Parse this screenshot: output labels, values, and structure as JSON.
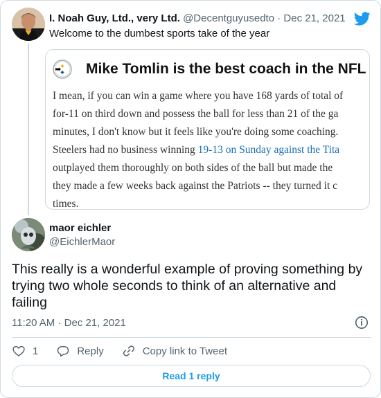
{
  "parent_tweet": {
    "author_name": "I. Noah Guy, Ltd., very Ltd.",
    "author_handle": "@Decentguyusedto",
    "separator": "·",
    "date": "Dec 21, 2021",
    "text": "Welcome to the dumbest sports take of the year",
    "embedded_article": {
      "title": "Mike Tomlin is the best coach in the NFL",
      "lines": [
        "I mean, if you can win a game where you have 168 yards of total of",
        "for-11 on third down and possess the ball for less than 21 of the ga",
        "minutes, I don't know but it feels like you're doing some coaching.",
        "outplayed them thoroughly on both sides of the ball but made the",
        "they made a few weeks back against the Patriots -- they turned it c",
        "times."
      ],
      "line4_prefix": "Steelers had no business winning ",
      "line4_link": "19-13 on Sunday against the Tita"
    }
  },
  "reply_tweet": {
    "author_name": "maor eichler",
    "author_handle": "@EichlerMaor",
    "text": "This really is a wonderful example of proving something by trying two whole seconds to think of an alternative and failing",
    "time": "11:20 AM",
    "separator": "·",
    "date": "Dec 21, 2021",
    "like_count": "1",
    "reply_label": "Reply",
    "copy_link_label": "Copy link to Tweet",
    "read_replies_label": "Read 1 reply"
  },
  "colors": {
    "twitter_blue": "#1d9bf0",
    "secondary_text": "#536471",
    "border": "#cfd9de",
    "article_link": "#1a6fb4"
  },
  "icons": [
    "twitter-bird-icon",
    "steelers-logo-icon",
    "info-icon",
    "heart-icon",
    "reply-icon",
    "link-icon"
  ]
}
